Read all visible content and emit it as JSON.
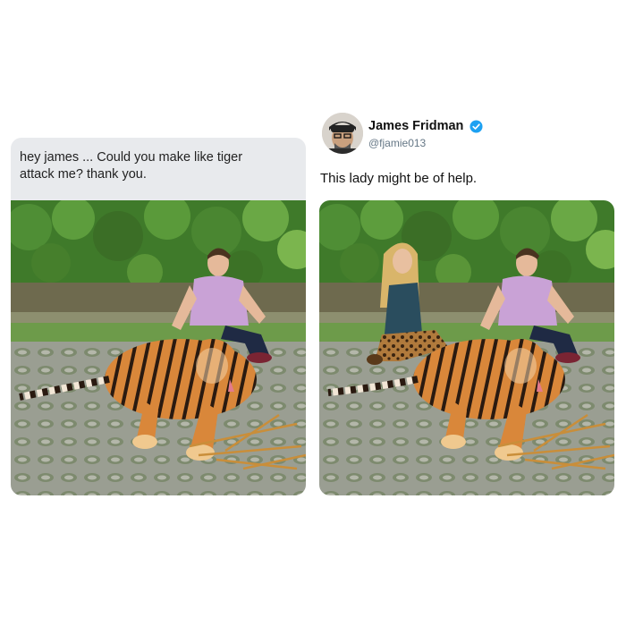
{
  "request": {
    "line1": "hey james ... Could you make like tiger",
    "line2": "attack me? thank you."
  },
  "tweet": {
    "display_name": "James Fridman",
    "handle": "@fjamie013",
    "verified_icon": "verified-badge-icon",
    "text": "This lady might be of help."
  },
  "colors": {
    "bubble": "#e8eaed",
    "verified": "#1da1f2"
  }
}
